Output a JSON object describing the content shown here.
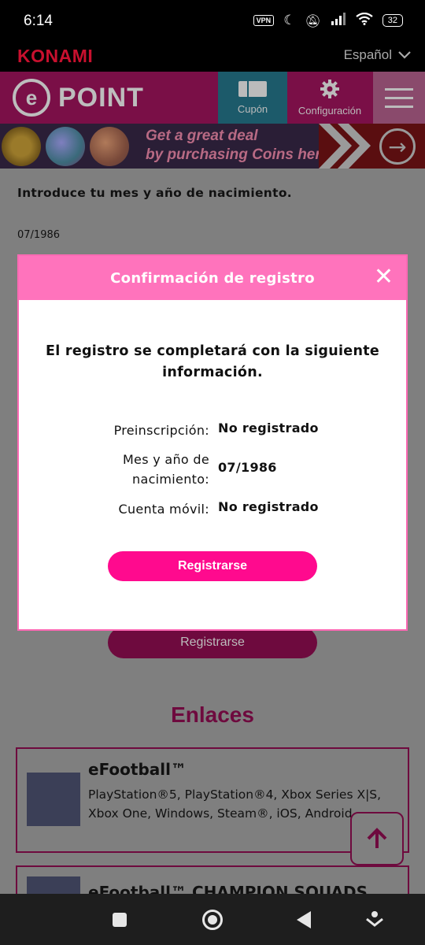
{
  "status": {
    "time": "6:14",
    "vpn": "VPN",
    "battery": "32"
  },
  "konami": {
    "logo": "KONAMI",
    "language": "Español"
  },
  "header": {
    "cupon_label": "Cupón",
    "config_label": "Configuración",
    "logo_text": "POINT"
  },
  "banner": {
    "line1": "Get a great deal",
    "line2": "by purchasing Coins here!"
  },
  "page": {
    "prompt": "Introduce tu mes y año de nacimiento.",
    "date": "07/1986",
    "register_label": "Registrarse",
    "links_heading": "Enlaces",
    "links": [
      {
        "title": "eFootball™",
        "platforms": "PlayStation®5, PlayStation®4, Xbox Series X|S, Xbox One, Windows, Steam®, iOS, Android"
      },
      {
        "title": "eFootball™ CHAMPION SQUADS"
      }
    ]
  },
  "modal": {
    "title": "Confirmación de registro",
    "message": "El registro se completará con la siguiente información.",
    "rows": [
      {
        "label": "Preinscripción:",
        "value": "No registrado"
      },
      {
        "label": "Mes y año de nacimiento:",
        "value": "07/1986"
      },
      {
        "label": "Cuenta móvil:",
        "value": "No registrado"
      }
    ],
    "button_label": "Registrarse"
  },
  "colors": {
    "accent": "#ff0a8e",
    "modal_header": "#ff73bc",
    "brand_dark": "#7a0f47"
  },
  "icons": [
    "wifi-icon",
    "signal-icon",
    "moon-icon",
    "mute-icon",
    "coupon-icon",
    "gear-icon",
    "hamburger-icon",
    "arrow-right-icon",
    "close-icon",
    "arrow-up-icon"
  ]
}
